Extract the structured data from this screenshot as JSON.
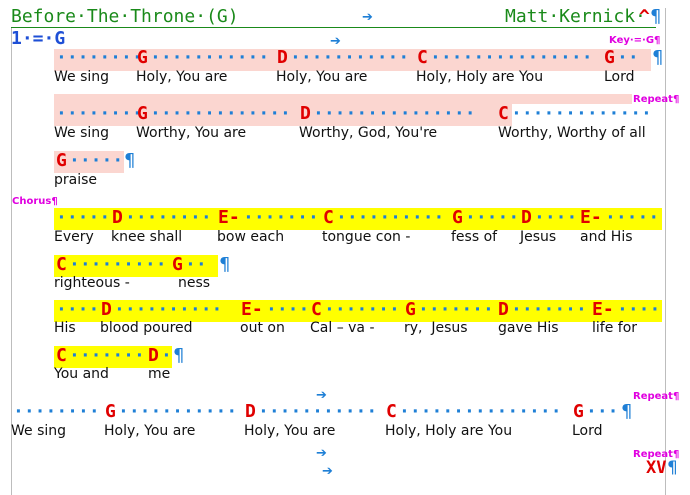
{
  "song": {
    "title": "Before·The·Throne·(G)",
    "author": "Matt·Kernick·",
    "caret": "^",
    "pilcrow": "¶",
    "key_line": "1·=·G",
    "key_tag": "Key·=·G¶",
    "arrow": "➔",
    "repeat_tag": "Repeat¶",
    "chorus_tag": "Chorus¶",
    "end_mark": "XV"
  },
  "chords": [
    "G",
    "D",
    "C",
    "E-"
  ],
  "lyrics": {
    "l1": [
      "We sing",
      "Holy, You are",
      "Holy, You are",
      "Holy, Holy are You",
      "Lord"
    ],
    "l2": [
      "We sing",
      "Worthy, You are",
      "Worthy, God, You're",
      "Worthy, Worthy of all"
    ],
    "l3": [
      "praise"
    ],
    "l4": [
      "Every",
      "knee shall",
      "bow each",
      "tongue con -",
      "fess of",
      "Jesus",
      "and His"
    ],
    "l5": [
      "righteous -",
      "ness"
    ],
    "l6": [
      "His",
      "blood poured",
      "out on",
      "Cal – va -",
      "ry,  Jesus",
      "gave His",
      "life for"
    ],
    "l7": [
      "You and",
      "me"
    ],
    "l8": [
      "We sing",
      "Holy, You are",
      "Holy, You are",
      "Holy, Holy are You",
      "Lord"
    ]
  },
  "colors": {
    "title_green": "#1a8a1a",
    "chord_red": "#e00000",
    "dot_blue": "#1e7fd6",
    "verse_highlight": "#fbd6d0",
    "chorus_highlight": "#ffff00",
    "tag_magenta": "#e000e0"
  }
}
